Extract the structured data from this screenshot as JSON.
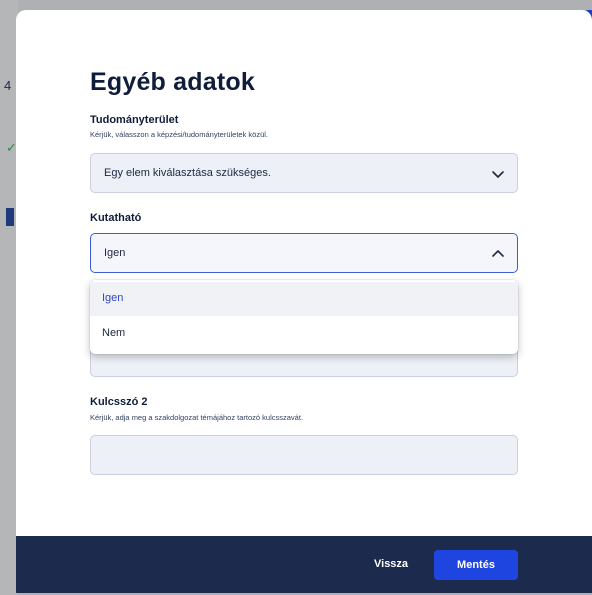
{
  "modal": {
    "title": "Egyéb adatok",
    "fields": [
      {
        "label": "Tudományterület",
        "hint": "Kérjük, válasszon a képzési/tudományterületek közül.",
        "value": "Egy elem kiválasztása szükséges.",
        "icon": "chevron-down-icon"
      },
      {
        "label": "Kutatható",
        "value": "Igen",
        "icon": "chevron-up-icon",
        "options": [
          "Igen",
          "Nem"
        ],
        "selected": "Igen"
      },
      {
        "label": "Kulcsszó 2",
        "hint": "Kérjük, adja meg a szakdolgozat témájához tartozó kulcsszavát.",
        "value": ""
      }
    ],
    "footer": {
      "back_label": "Vissza",
      "save_label": "Mentés"
    }
  },
  "colors": {
    "accent": "#1f45e0",
    "footer_bg": "#1c2a4e",
    "title": "#0f1d3a",
    "selected_option": "#2e49c9"
  }
}
